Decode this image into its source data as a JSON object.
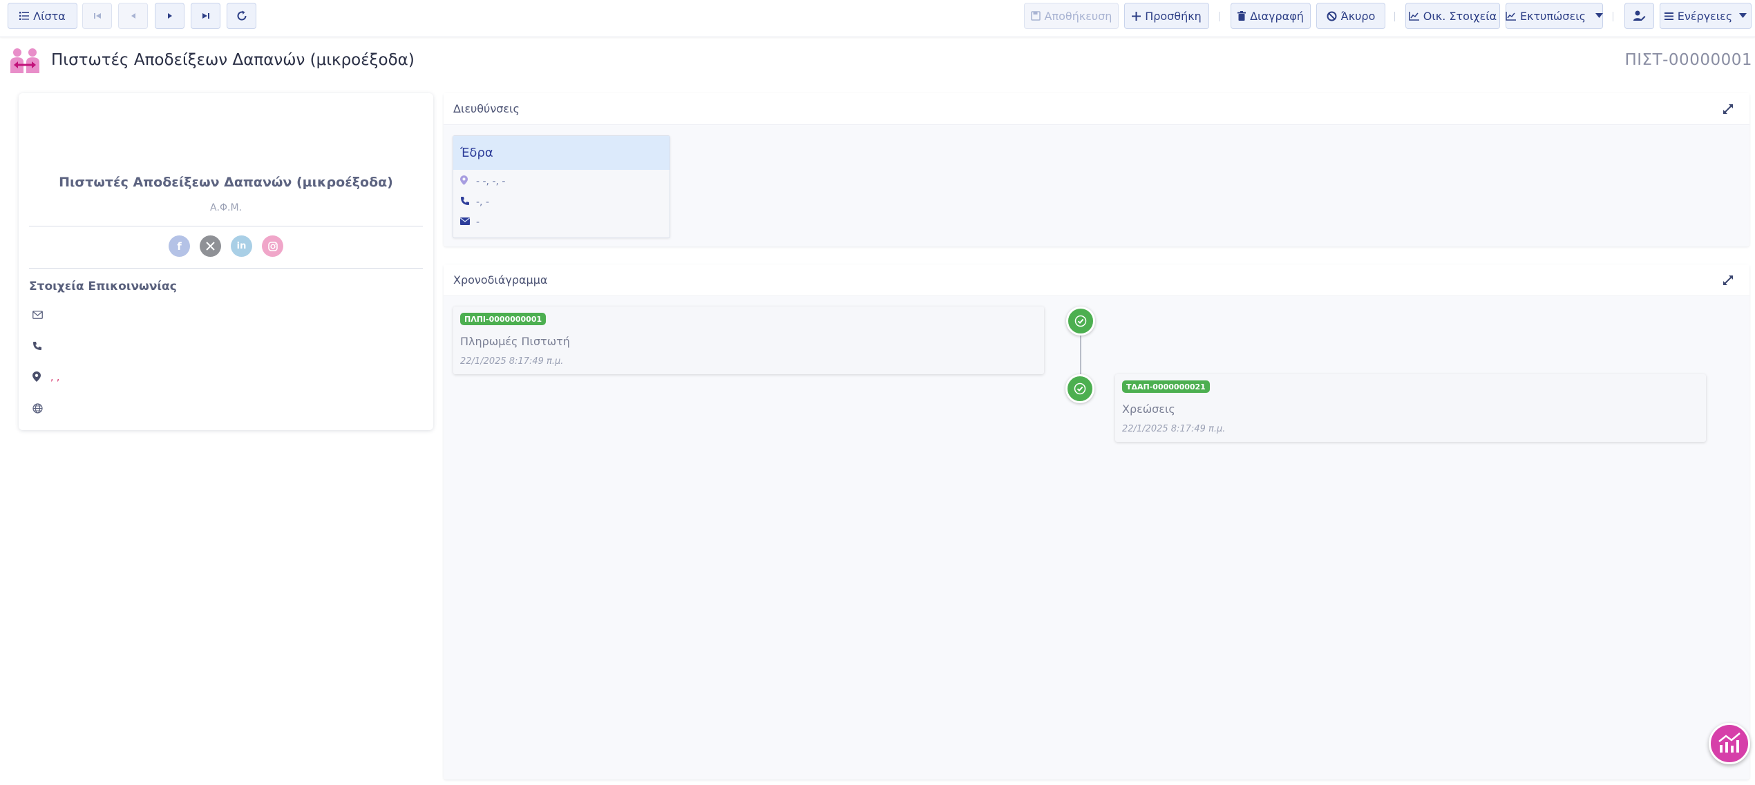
{
  "toolbar": {
    "list_label": "Λίστα",
    "save_label": "Αποθήκευση",
    "add_label": "Προσθήκη",
    "delete_label": "Διαγραφή",
    "cancel_label": "Άκυρο",
    "financial_label": "Οικ. Στοιχεία",
    "prints_label": "Εκτυπώσεις",
    "actions_label": "Ενέργειες"
  },
  "header": {
    "title": "Πιστωτές Αποδείξεων Δαπανών (μικροέξοδα)",
    "record_code": "ΠΙΣΤ-00000001"
  },
  "profile": {
    "name": "Πιστωτές Αποδείξεων Δαπανών (μικροέξοδα)",
    "afm_label": "Α.Φ.Μ.",
    "contact_title": "Στοιχεία Επικοινωνίας",
    "address_value": ", ,",
    "socials": [
      "facebook-icon",
      "x-icon",
      "linkedin-icon",
      "instagram-icon"
    ]
  },
  "addresses": {
    "panel_title": "Διευθύνσεις",
    "card_title": "Έδρα",
    "address": "- -, -, -",
    "phone": "-, -",
    "email": "-"
  },
  "timeline": {
    "panel_title": "Χρονοδιάγραμμα",
    "items": [
      {
        "badge": "ΠΛΠΙ-0000000001",
        "title": "Πληρωμές Πιστωτή",
        "date": "22/1/2025 8:17:49 π.μ."
      },
      {
        "badge": "ΤΔΑΠ-0000000021",
        "title": "Χρεώσεις",
        "date": "22/1/2025 8:17:49 π.μ."
      }
    ]
  },
  "colors": {
    "accent": "#2d3f86",
    "success": "#4caf50",
    "brand": "#d63fa9"
  }
}
